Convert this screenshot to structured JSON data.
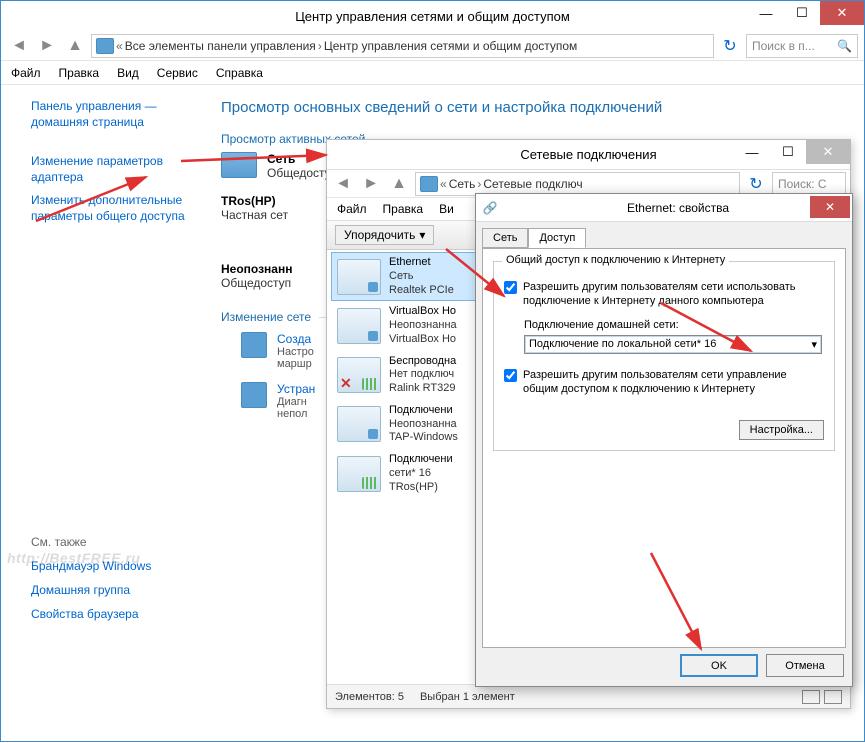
{
  "w1": {
    "title": "Центр управления сетями и общим доступом",
    "breadcrumbs": {
      "b1": "Все элементы панели управления",
      "b2": "Центр управления сетями и общим доступом"
    },
    "search_ph": "Поиск в п...",
    "menu": {
      "file": "Файл",
      "edit": "Правка",
      "view": "Вид",
      "tools": "Сервис",
      "help": "Справка"
    },
    "sidebar": {
      "home1": "Панель управления —",
      "home2": "домашняя страница",
      "l1": "Изменение параметров",
      "l1b": "адаптера",
      "l2": "Изменить дополнительные",
      "l2b": "параметры общего доступа",
      "see_also": "См. также",
      "r1": "Брандмауэр Windows",
      "r2": "Домашняя группа",
      "r3": "Свойства браузера"
    },
    "content": {
      "heading": "Просмотр основных сведений о сети и настройка подключений",
      "active_label": "Просмотр активных сетей",
      "n1": {
        "name": "Сеть",
        "type": "Общедоступ"
      },
      "n2": {
        "name": "TRos(HP)",
        "type": "Частная сет"
      },
      "n3": {
        "name": "Неопознанн",
        "type": "Общедоступ"
      },
      "change_label": "Изменение сете",
      "c1": {
        "title": "Созда",
        "d1": "Настро",
        "d2": "маршр"
      },
      "c2": {
        "title": "Устран",
        "d1": "Диагн",
        "d2": "непол"
      }
    }
  },
  "w2": {
    "title": "Сетевые подключения",
    "crumb1": "Сеть",
    "crumb2": "Сетевые подключ",
    "search_ph": "Поиск: С",
    "menu": {
      "file": "Файл",
      "edit": "Правка",
      "view": "Ви"
    },
    "organize": "Упорядочить",
    "adapters": [
      {
        "name": "Ethernet",
        "l2": "Сеть",
        "l3": "Realtek PCIe"
      },
      {
        "name": "VirtualBox Hо",
        "l2": "Неопознанна",
        "l3": "VirtualBox Hо"
      },
      {
        "name": "Беспроводна",
        "l2": "Нет подключ",
        "l3": "Ralink RT329"
      },
      {
        "name": "Подключени",
        "l2": "Неопознанна",
        "l3": "TAP-Windows"
      },
      {
        "name": "Подключени",
        "l2": "сети* 16",
        "l3": "TRos(HP)"
      }
    ],
    "status": {
      "count": "Элементов: 5",
      "sel": "Выбран 1 элемент"
    }
  },
  "w3": {
    "title": "Ethernet: свойства",
    "tabs": {
      "t1": "Сеть",
      "t2": "Доступ"
    },
    "grp_title": "Общий доступ к подключению к Интернету",
    "chk1": "Разрешить другим пользователям сети использовать подключение к Интернету данного компьютера",
    "combolabel": "Подключение домашней сети:",
    "combo": "Подключение по локальной сети* 16",
    "chk2": "Разрешить другим пользователям сети управление общим доступом к подключению к Интернету",
    "cfg": "Настройка...",
    "ok": "OK",
    "cancel": "Отмена"
  },
  "watermark": "http://BestFREE.ru"
}
